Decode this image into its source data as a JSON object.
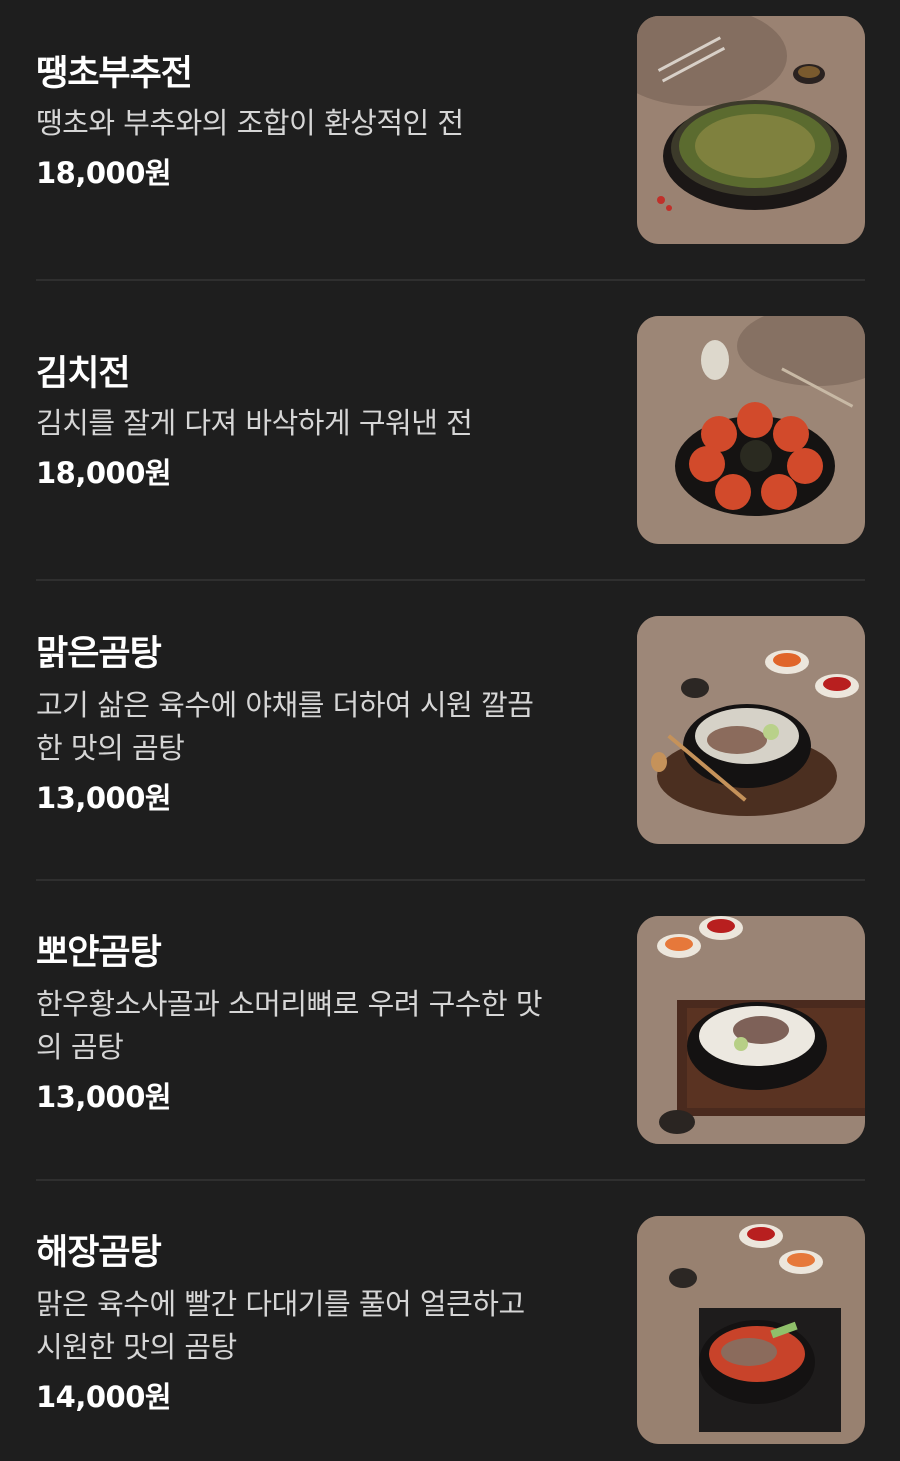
{
  "menu": {
    "items": [
      {
        "name": "땡초부추전",
        "description": "땡초와 부추와의 조합이 환상적인 전",
        "price": "18,000원",
        "image_icon": "leek-pancake-photo"
      },
      {
        "name": "김치전",
        "description": "김치를 잘게 다져 바삭하게 구워낸 전",
        "price": "18,000원",
        "image_icon": "kimchi-pancake-photo"
      },
      {
        "name": "맑은곰탕",
        "description_lines": [
          "고기 삶은 육수에 야채를 더하여 시원 깔끔",
          "한 맛의 곰탕"
        ],
        "price": "13,000원",
        "image_icon": "clear-gomtang-photo"
      },
      {
        "name": "뽀얀곰탕",
        "description_lines": [
          "한우황소사골과 소머리뼈로 우려 구수한 맛",
          "의 곰탕"
        ],
        "price": "13,000원",
        "image_icon": "milky-gomtang-photo"
      },
      {
        "name": "해장곰탕",
        "description_lines": [
          "맑은 육수에 빨간 다대기를 풀어 얼큰하고",
          "시원한 맛의 곰탕"
        ],
        "price": "14,000원",
        "image_icon": "spicy-gomtang-photo"
      }
    ]
  },
  "colors": {
    "background": "#1e1e1e",
    "divider": "#2f2f2f",
    "text_primary": "#ffffff",
    "text_secondary": "#d6d6d6"
  }
}
